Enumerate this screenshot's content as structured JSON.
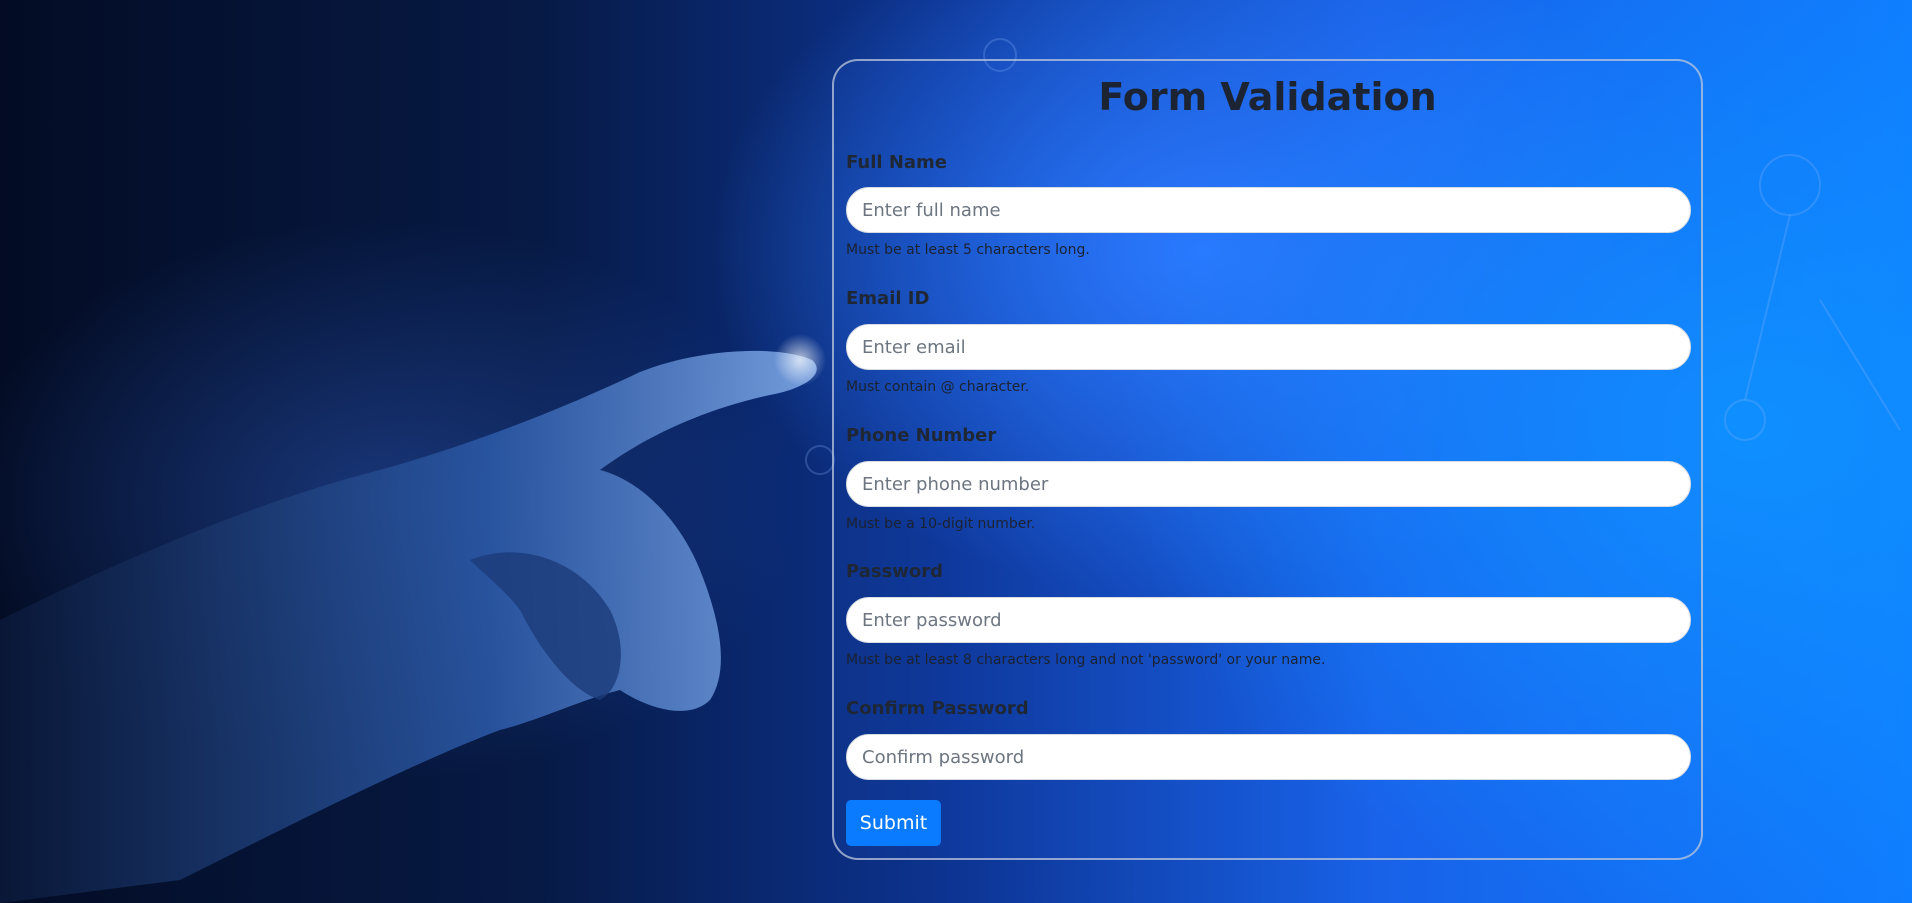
{
  "form": {
    "title": "Form Validation",
    "fields": [
      {
        "label": "Full Name",
        "placeholder": "Enter full name",
        "hint": "Must be at least 5 characters long."
      },
      {
        "label": "Email ID",
        "placeholder": "Enter email",
        "hint": "Must contain @ character."
      },
      {
        "label": "Phone Number",
        "placeholder": "Enter phone number",
        "hint": "Must be a 10-digit number."
      },
      {
        "label": "Password",
        "placeholder": "Enter password",
        "hint": "Must be at least 8 characters long and not 'password' or your name."
      },
      {
        "label": "Confirm Password",
        "placeholder": "Confirm password",
        "hint": ""
      }
    ],
    "submit_label": "Submit"
  },
  "colors": {
    "accent": "#0a7bff",
    "text": "#1c2433",
    "card_border": "#bec8dc"
  },
  "icons": {
    "background": "hand-touch-illustration"
  }
}
